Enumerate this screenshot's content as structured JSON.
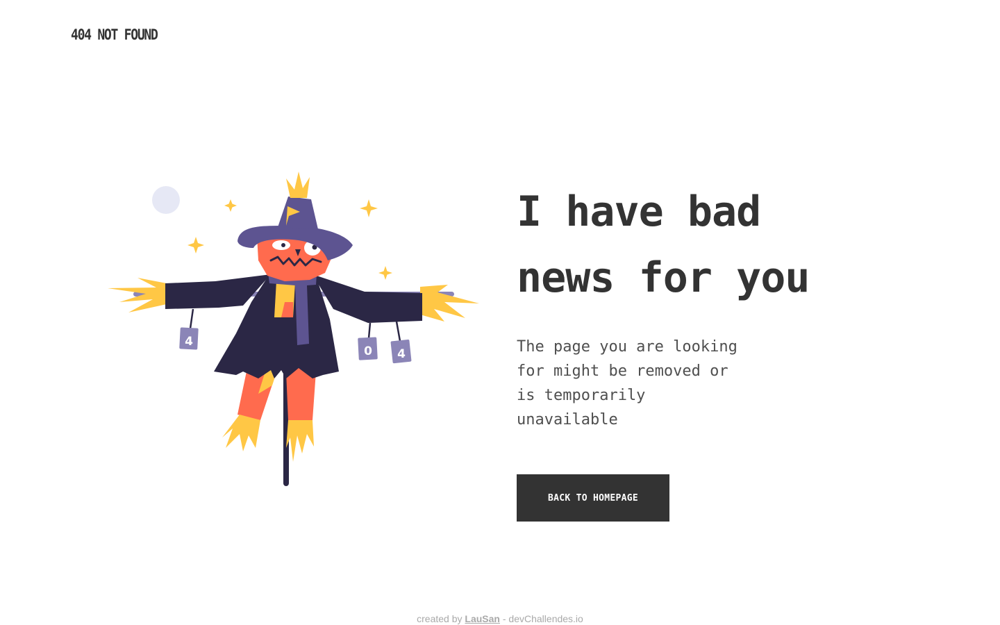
{
  "brand": {
    "title": "404 NOT FOUND"
  },
  "main": {
    "headline": "I have bad news for you",
    "subtext": "The page you are looking for might be removed or is temporarily unavailable",
    "cta_label": "BACK TO HOMEPAGE"
  },
  "illustration": {
    "icon": "scarecrow-illustration",
    "can_labels": [
      "4",
      "0",
      "4"
    ]
  },
  "footer": {
    "prefix": "created by",
    "author": "LauSan",
    "suffix": " - devChallendes.io"
  },
  "colors": {
    "text": "#333333",
    "button_bg": "#333333",
    "button_text": "#ffffff",
    "footer_text": "#a9a9a9",
    "scarecrow_coat": "#2b2745",
    "scarecrow_hat": "#5d5491",
    "scarecrow_face": "#ff6b4e",
    "straw": "#ffc745",
    "moon": "#e6e8f5"
  }
}
